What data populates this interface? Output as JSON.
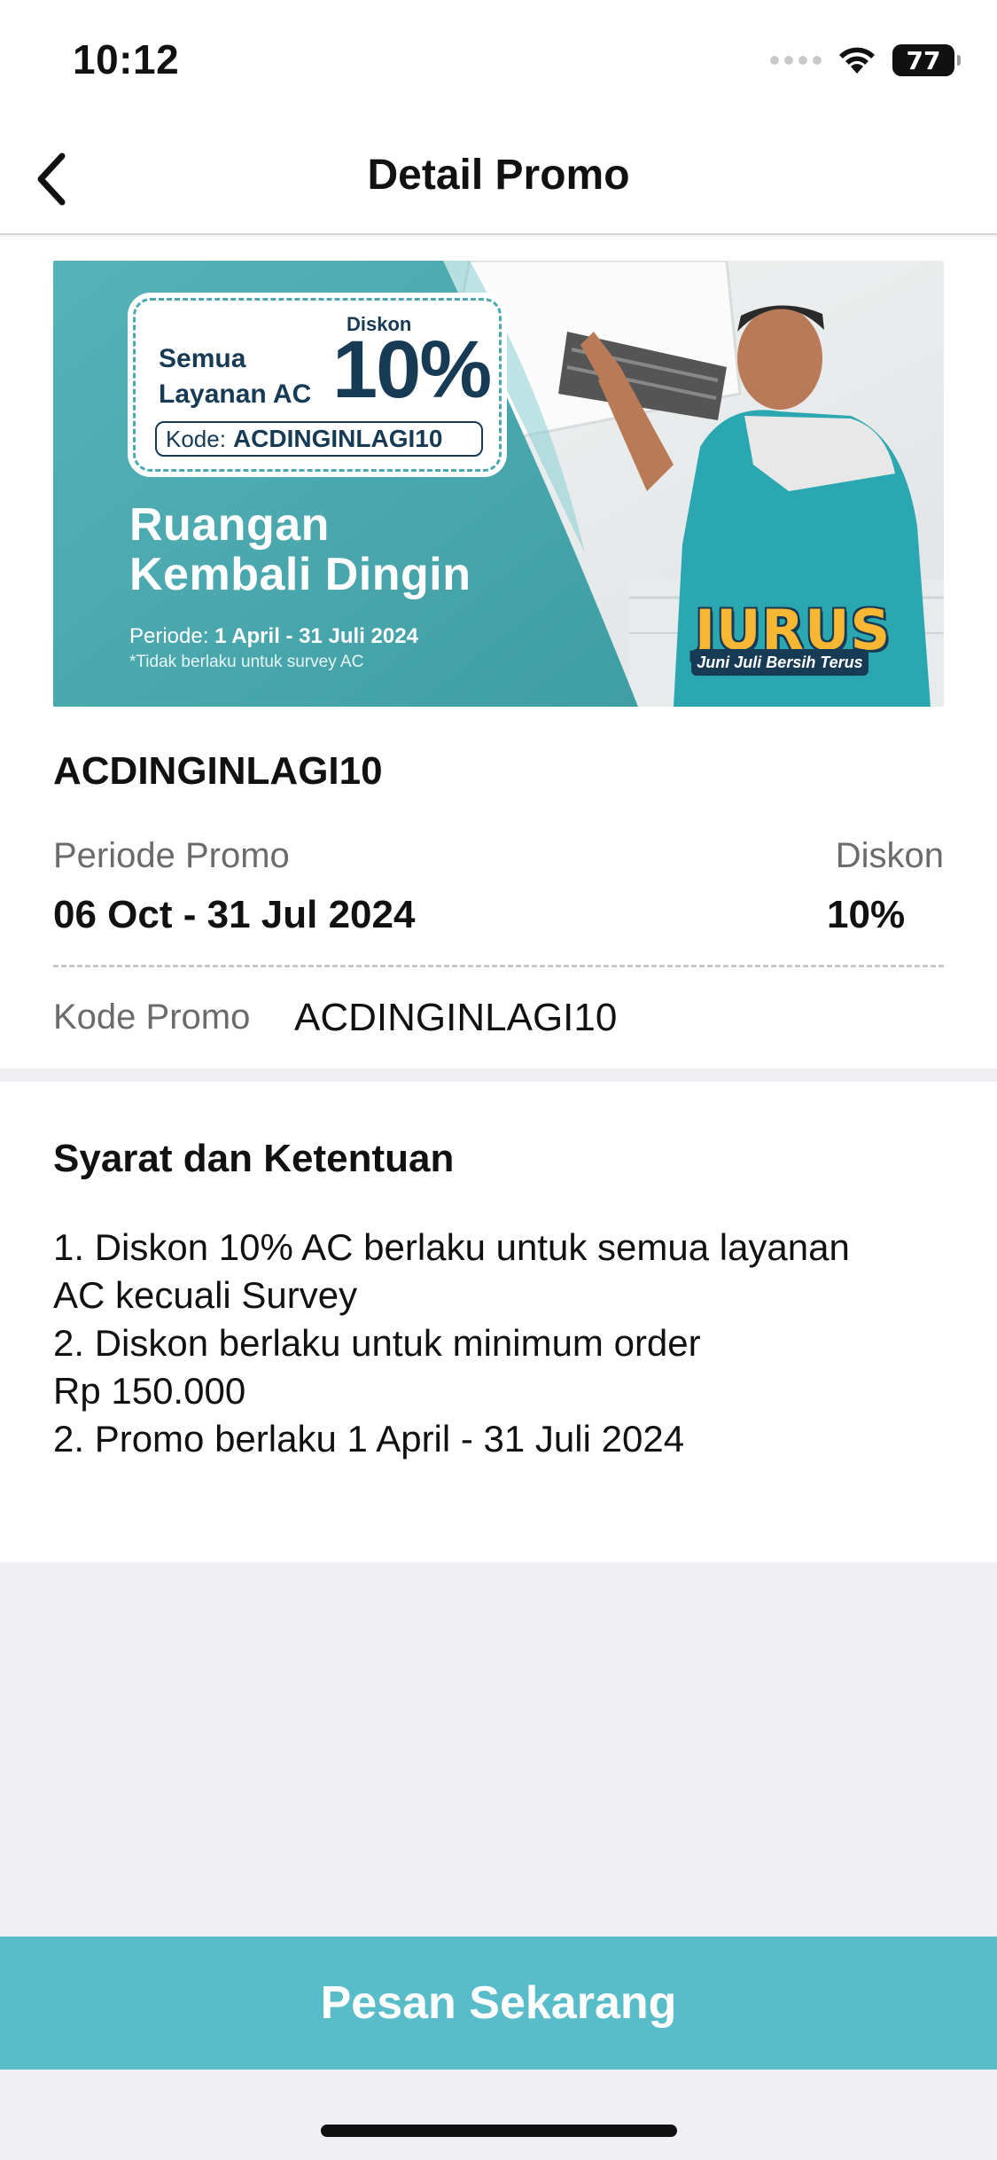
{
  "status_bar": {
    "time": "10:12",
    "battery": "77"
  },
  "nav": {
    "title": "Detail Promo",
    "back_icon": "chevron-left-icon"
  },
  "banner": {
    "card_line1": "Semua",
    "card_line2": "Layanan AC",
    "card_discount_label": "Diskon",
    "card_discount_value": "10%",
    "code_label": "Kode:",
    "code_value": "ACDINGINLAGI10",
    "headline_line1": "Ruangan",
    "headline_line2": "Kembali Dingin",
    "period_label": "Periode:",
    "period_value": "1 April - 31 Juli 2024",
    "note": "*Tidak berlaku untuk survey AC",
    "logo_text": "JURUS",
    "logo_tagline": "Juni Juli Bersih Terus",
    "colors": {
      "teal": "#4aa8ae",
      "navy": "#173a55",
      "gold": "#f7b733"
    }
  },
  "promo": {
    "name": "ACDINGINLAGI10",
    "period_label": "Periode Promo",
    "period_value": "06 Oct - 31 Jul 2024",
    "discount_label": "Diskon",
    "discount_value": "10%",
    "code_label": "Kode Promo",
    "code_value": "ACDINGINLAGI10"
  },
  "terms": {
    "title": "Syarat dan Ketentuan",
    "lines": [
      "1. Diskon 10% AC berlaku untuk semua layanan",
      "AC kecuali Survey",
      "2. Diskon berlaku untuk minimum order",
      "Rp 150.000",
      "2. Promo berlaku 1 April - 31 Juli 2024"
    ]
  },
  "footer": {
    "order_button_label": "Pesan Sekarang",
    "button_color": "#58bcc9"
  }
}
